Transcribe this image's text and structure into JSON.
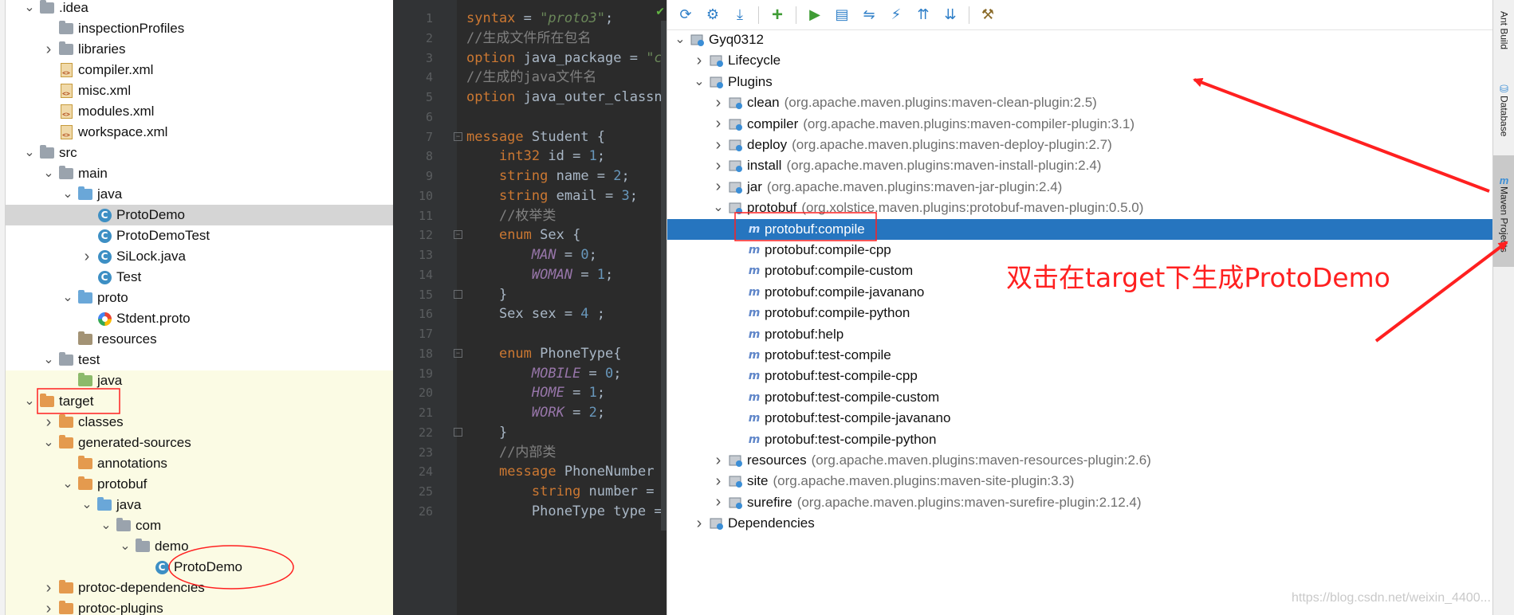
{
  "project_tree": {
    "items": [
      {
        "label": ".idea",
        "indent": 1,
        "arrow": "open",
        "icon": "folder-grey"
      },
      {
        "label": "inspectionProfiles",
        "indent": 2,
        "arrow": "",
        "icon": "folder-grey"
      },
      {
        "label": "libraries",
        "indent": 2,
        "arrow": "closed",
        "icon": "folder-grey"
      },
      {
        "label": "compiler.xml",
        "indent": 2,
        "arrow": "",
        "icon": "xml-file"
      },
      {
        "label": "misc.xml",
        "indent": 2,
        "arrow": "",
        "icon": "xml-file"
      },
      {
        "label": "modules.xml",
        "indent": 2,
        "arrow": "",
        "icon": "xml-file"
      },
      {
        "label": "workspace.xml",
        "indent": 2,
        "arrow": "",
        "icon": "xml-file"
      },
      {
        "label": "src",
        "indent": 1,
        "arrow": "open",
        "icon": "folder-grey"
      },
      {
        "label": "main",
        "indent": 2,
        "arrow": "open",
        "icon": "folder-grey"
      },
      {
        "label": "java",
        "indent": 3,
        "arrow": "open",
        "icon": "folder-blue"
      },
      {
        "label": "ProtoDemo",
        "indent": 4,
        "arrow": "",
        "icon": "java-class",
        "selected": true
      },
      {
        "label": "ProtoDemoTest",
        "indent": 4,
        "arrow": "",
        "icon": "java-class"
      },
      {
        "label": "SiLock.java",
        "indent": 4,
        "arrow": "closed",
        "icon": "java-class"
      },
      {
        "label": "Test",
        "indent": 4,
        "arrow": "",
        "icon": "java-class"
      },
      {
        "label": "proto",
        "indent": 3,
        "arrow": "open",
        "icon": "folder-blue"
      },
      {
        "label": "Stdent.proto",
        "indent": 4,
        "arrow": "",
        "icon": "proto-file"
      },
      {
        "label": "resources",
        "indent": 3,
        "arrow": "",
        "icon": "folder-resources"
      },
      {
        "label": "test",
        "indent": 2,
        "arrow": "open",
        "icon": "folder-grey"
      },
      {
        "label": "java",
        "indent": 3,
        "arrow": "",
        "icon": "folder-green",
        "excluded": true
      },
      {
        "label": "target",
        "indent": 1,
        "arrow": "open",
        "icon": "folder-orange",
        "excluded": true
      },
      {
        "label": "classes",
        "indent": 2,
        "arrow": "closed",
        "icon": "folder-orange",
        "excluded": true
      },
      {
        "label": "generated-sources",
        "indent": 2,
        "arrow": "open",
        "icon": "folder-orange",
        "excluded": true
      },
      {
        "label": "annotations",
        "indent": 3,
        "arrow": "",
        "icon": "folder-orange",
        "excluded": true
      },
      {
        "label": "protobuf",
        "indent": 3,
        "arrow": "open",
        "icon": "folder-orange",
        "excluded": true
      },
      {
        "label": "java",
        "indent": 4,
        "arrow": "open",
        "icon": "folder-blue-src",
        "excluded": true
      },
      {
        "label": "com",
        "indent": 5,
        "arrow": "open",
        "icon": "folder-grey",
        "excluded": true
      },
      {
        "label": "demo",
        "indent": 6,
        "arrow": "open",
        "icon": "folder-grey",
        "excluded": true
      },
      {
        "label": "ProtoDemo",
        "indent": 7,
        "arrow": "",
        "icon": "java-class",
        "excluded": true
      },
      {
        "label": "protoc-dependencies",
        "indent": 2,
        "arrow": "closed",
        "icon": "folder-orange",
        "excluded": true
      },
      {
        "label": "protoc-plugins",
        "indent": 2,
        "arrow": "closed",
        "icon": "folder-orange",
        "excluded": true
      }
    ]
  },
  "editor": {
    "line_numbers": [
      "1",
      "2",
      "3",
      "4",
      "5",
      "6",
      "7",
      "8",
      "9",
      "10",
      "11",
      "12",
      "13",
      "14",
      "15",
      "16",
      "17",
      "18",
      "19",
      "20",
      "21",
      "22",
      "23",
      "24",
      "25",
      "26"
    ],
    "lines": [
      [
        [
          "kw",
          "syntax"
        ],
        [
          "p",
          " = "
        ],
        [
          "str",
          "\"proto3\""
        ],
        [
          "p",
          ";"
        ]
      ],
      [
        [
          "cmt",
          "//生成文件所在包名"
        ]
      ],
      [
        [
          "kw",
          "option"
        ],
        [
          "p",
          " java_package = "
        ],
        [
          "str",
          "\"c"
        ]
      ],
      [
        [
          "cmt",
          "//生成的java文件名"
        ]
      ],
      [
        [
          "kw",
          "option"
        ],
        [
          "p",
          " java_outer_classn"
        ]
      ],
      [],
      [
        [
          "kw",
          "message"
        ],
        [
          "p",
          " Student {"
        ]
      ],
      [
        [
          "p",
          "    "
        ],
        [
          "kw",
          "int32"
        ],
        [
          "p",
          " id = "
        ],
        [
          "num",
          "1"
        ],
        [
          "p",
          ";"
        ]
      ],
      [
        [
          "p",
          "    "
        ],
        [
          "kw",
          "string"
        ],
        [
          "p",
          " name = "
        ],
        [
          "num",
          "2"
        ],
        [
          "p",
          ";"
        ]
      ],
      [
        [
          "p",
          "    "
        ],
        [
          "kw",
          "string"
        ],
        [
          "p",
          " email = "
        ],
        [
          "num",
          "3"
        ],
        [
          "p",
          ";"
        ]
      ],
      [
        [
          "p",
          "    "
        ],
        [
          "cmt",
          "//枚举类"
        ]
      ],
      [
        [
          "p",
          "    "
        ],
        [
          "kw",
          "enum"
        ],
        [
          "p",
          " Sex {"
        ]
      ],
      [
        [
          "p",
          "        "
        ],
        [
          "enumc",
          "MAN"
        ],
        [
          "p",
          " = "
        ],
        [
          "num",
          "0"
        ],
        [
          "p",
          ";"
        ]
      ],
      [
        [
          "p",
          "        "
        ],
        [
          "enumc",
          "WOMAN"
        ],
        [
          "p",
          " = "
        ],
        [
          "num",
          "1"
        ],
        [
          "p",
          ";"
        ]
      ],
      [
        [
          "p",
          "    }"
        ]
      ],
      [
        [
          "p",
          "    Sex sex = "
        ],
        [
          "num",
          "4"
        ],
        [
          "p",
          " ;"
        ]
      ],
      [],
      [
        [
          "p",
          "    "
        ],
        [
          "kw",
          "enum"
        ],
        [
          "p",
          " PhoneType{"
        ]
      ],
      [
        [
          "p",
          "        "
        ],
        [
          "enumc",
          "MOBILE"
        ],
        [
          "p",
          " = "
        ],
        [
          "num",
          "0"
        ],
        [
          "p",
          ";"
        ]
      ],
      [
        [
          "p",
          "        "
        ],
        [
          "enumc",
          "HOME"
        ],
        [
          "p",
          " = "
        ],
        [
          "num",
          "1"
        ],
        [
          "p",
          ";"
        ]
      ],
      [
        [
          "p",
          "        "
        ],
        [
          "enumc",
          "WORK"
        ],
        [
          "p",
          " = "
        ],
        [
          "num",
          "2"
        ],
        [
          "p",
          ";"
        ]
      ],
      [
        [
          "p",
          "    }"
        ]
      ],
      [
        [
          "p",
          "    "
        ],
        [
          "cmt",
          "//内部类"
        ]
      ],
      [
        [
          "p",
          "    "
        ],
        [
          "kw",
          "message"
        ],
        [
          "p",
          " PhoneNumber"
        ]
      ],
      [
        [
          "p",
          "        "
        ],
        [
          "kw",
          "string"
        ],
        [
          "p",
          " number = "
        ]
      ],
      [
        [
          "p",
          "        PhoneType type = "
        ]
      ]
    ]
  },
  "maven": {
    "toolbar": [
      "reimport-icon",
      "generate-sources-icon",
      "download-icon",
      "add-icon",
      "run-icon",
      "run-config-icon",
      "toggle-offline-icon",
      "skip-tests-icon",
      "expand-all-icon",
      "collapse-all-icon",
      "settings-icon"
    ],
    "tree": [
      {
        "label": "Gyq0312",
        "coord": "",
        "indent": 0,
        "arrow": "open",
        "icon": "project"
      },
      {
        "label": "Lifecycle",
        "coord": "",
        "indent": 1,
        "arrow": "closed",
        "icon": "gear-folder"
      },
      {
        "label": "Plugins",
        "coord": "",
        "indent": 1,
        "arrow": "open",
        "icon": "gear-folder"
      },
      {
        "label": "clean",
        "coord": "(org.apache.maven.plugins:maven-clean-plugin:2.5)",
        "indent": 2,
        "arrow": "closed",
        "icon": "plugin"
      },
      {
        "label": "compiler",
        "coord": "(org.apache.maven.plugins:maven-compiler-plugin:3.1)",
        "indent": 2,
        "arrow": "closed",
        "icon": "plugin"
      },
      {
        "label": "deploy",
        "coord": "(org.apache.maven.plugins:maven-deploy-plugin:2.7)",
        "indent": 2,
        "arrow": "closed",
        "icon": "plugin"
      },
      {
        "label": "install",
        "coord": "(org.apache.maven.plugins:maven-install-plugin:2.4)",
        "indent": 2,
        "arrow": "closed",
        "icon": "plugin"
      },
      {
        "label": "jar",
        "coord": "(org.apache.maven.plugins:maven-jar-plugin:2.4)",
        "indent": 2,
        "arrow": "closed",
        "icon": "plugin"
      },
      {
        "label": "protobuf",
        "coord": "(org.xolstice.maven.plugins:protobuf-maven-plugin:0.5.0)",
        "indent": 2,
        "arrow": "open",
        "icon": "plugin"
      },
      {
        "label": "protobuf:compile",
        "coord": "",
        "indent": 3,
        "arrow": "",
        "icon": "goal",
        "selected": true
      },
      {
        "label": "protobuf:compile-cpp",
        "coord": "",
        "indent": 3,
        "arrow": "",
        "icon": "goal"
      },
      {
        "label": "protobuf:compile-custom",
        "coord": "",
        "indent": 3,
        "arrow": "",
        "icon": "goal"
      },
      {
        "label": "protobuf:compile-javanano",
        "coord": "",
        "indent": 3,
        "arrow": "",
        "icon": "goal"
      },
      {
        "label": "protobuf:compile-python",
        "coord": "",
        "indent": 3,
        "arrow": "",
        "icon": "goal"
      },
      {
        "label": "protobuf:help",
        "coord": "",
        "indent": 3,
        "arrow": "",
        "icon": "goal"
      },
      {
        "label": "protobuf:test-compile",
        "coord": "",
        "indent": 3,
        "arrow": "",
        "icon": "goal"
      },
      {
        "label": "protobuf:test-compile-cpp",
        "coord": "",
        "indent": 3,
        "arrow": "",
        "icon": "goal"
      },
      {
        "label": "protobuf:test-compile-custom",
        "coord": "",
        "indent": 3,
        "arrow": "",
        "icon": "goal"
      },
      {
        "label": "protobuf:test-compile-javanano",
        "coord": "",
        "indent": 3,
        "arrow": "",
        "icon": "goal"
      },
      {
        "label": "protobuf:test-compile-python",
        "coord": "",
        "indent": 3,
        "arrow": "",
        "icon": "goal"
      },
      {
        "label": "resources",
        "coord": "(org.apache.maven.plugins:maven-resources-plugin:2.6)",
        "indent": 2,
        "arrow": "closed",
        "icon": "plugin"
      },
      {
        "label": "site",
        "coord": "(org.apache.maven.plugins:maven-site-plugin:3.3)",
        "indent": 2,
        "arrow": "closed",
        "icon": "plugin"
      },
      {
        "label": "surefire",
        "coord": "(org.apache.maven.plugins:maven-surefire-plugin:2.12.4)",
        "indent": 2,
        "arrow": "closed",
        "icon": "plugin"
      },
      {
        "label": "Dependencies",
        "coord": "",
        "indent": 1,
        "arrow": "closed",
        "icon": "dependencies"
      }
    ]
  },
  "right_tabs": [
    {
      "label": "Ant Build",
      "active": false
    },
    {
      "label": "Database",
      "active": false
    },
    {
      "label": "Maven Projects",
      "active": true
    }
  ],
  "annotation": {
    "text": "双击在target下生成ProtoDemo",
    "color": "#ff2020"
  },
  "watermark": "https://blog.csdn.net/weixin_4400...",
  "colors": {
    "selection": "#2675bf",
    "editor_bg": "#2b2b2b",
    "keyword": "#cc7832",
    "string": "#6a8759",
    "comment": "#808080",
    "number": "#6897bb",
    "enum_const": "#9876aa",
    "annotation_red": "#ff2020"
  }
}
